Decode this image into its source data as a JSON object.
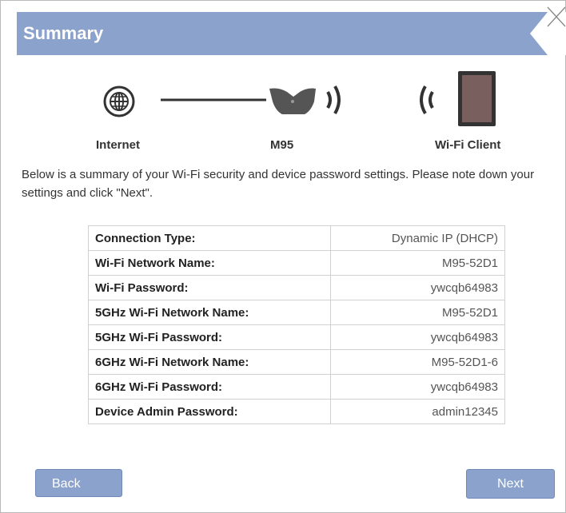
{
  "dialog": {
    "title": "Summary"
  },
  "diagram": {
    "internet_label": "Internet",
    "device_label": "M95",
    "client_label": "Wi-Fi Client",
    "icons": [
      "globe-icon",
      "router-icon",
      "wifi-waves-icon",
      "tablet-icon"
    ]
  },
  "intro_text": "Below is a summary of your Wi-Fi security and device password settings. Please note down your settings and click \"Next\".",
  "summary": {
    "rows": [
      {
        "label": "Connection Type:",
        "value": "Dynamic IP (DHCP)"
      },
      {
        "label": "Wi-Fi Network Name:",
        "value": "M95-52D1"
      },
      {
        "label": "Wi-Fi Password:",
        "value": "ywcqb64983"
      },
      {
        "label": "5GHz Wi-Fi Network Name:",
        "value": "M95-52D1"
      },
      {
        "label": "5GHz Wi-Fi Password:",
        "value": "ywcqb64983"
      },
      {
        "label": "6GHz Wi-Fi Network Name:",
        "value": "M95-52D1-6"
      },
      {
        "label": "6GHz Wi-Fi Password:",
        "value": "ywcqb64983"
      },
      {
        "label": "Device Admin Password:",
        "value": "admin12345"
      }
    ]
  },
  "buttons": {
    "back_label": "Back",
    "next_label": "Next"
  },
  "colors": {
    "header_blue": "#8aa2cc",
    "button_blue": "#8aa2cc"
  }
}
